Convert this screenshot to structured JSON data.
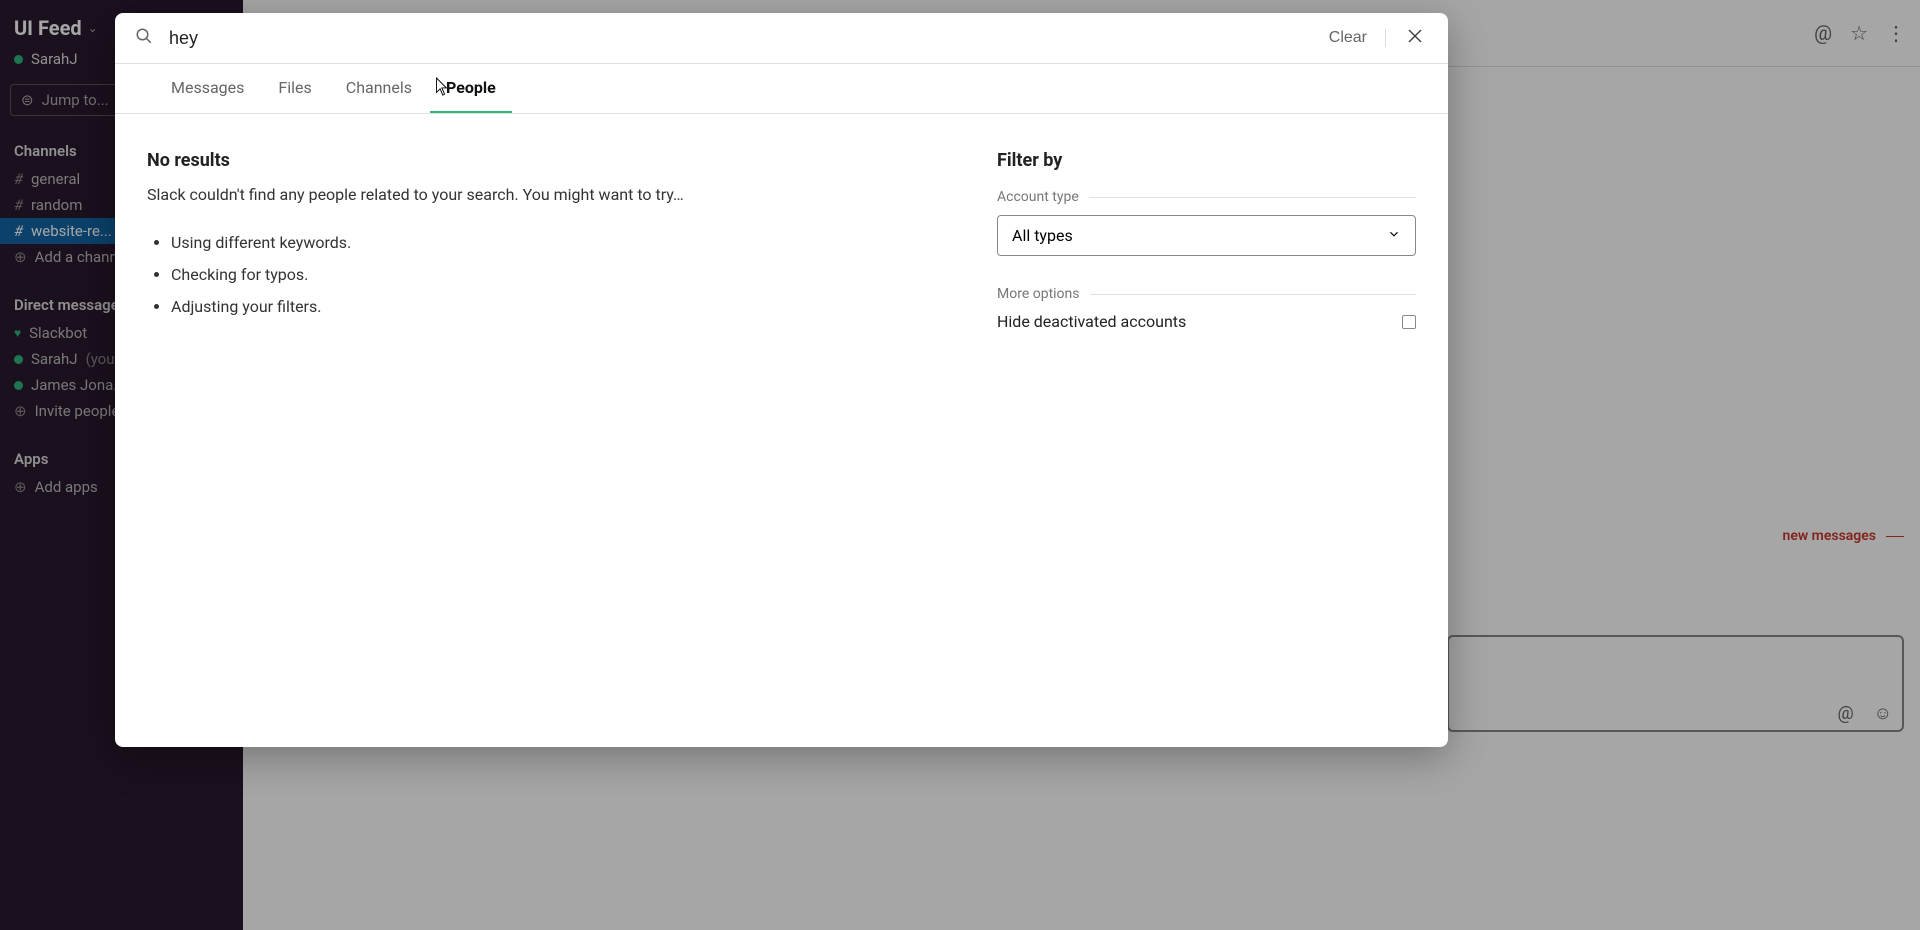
{
  "workspace": {
    "title": "UI Feed",
    "user": "SarahJ"
  },
  "jump_to": "Jump to...",
  "sidebar": {
    "channels_header": "Channels",
    "channels": [
      {
        "name": "general"
      },
      {
        "name": "random"
      },
      {
        "name": "website-re..."
      }
    ],
    "add_channel": "Add a channel",
    "dm_header": "Direct messages",
    "dms": [
      {
        "name": "Slackbot",
        "icon": "heart"
      },
      {
        "name": "SarahJ",
        "suffix": "(you)",
        "icon": "dot"
      },
      {
        "name": "James Jona...",
        "icon": "dot"
      }
    ],
    "invite": "Invite people",
    "apps_header": "Apps",
    "add_apps": "Add apps"
  },
  "top_bar": {
    "icons": [
      "mention",
      "star",
      "more"
    ]
  },
  "new_messages": "new messages",
  "search": {
    "query": "hey",
    "clear": "Clear",
    "tabs": [
      "Messages",
      "Files",
      "Channels",
      "People"
    ],
    "active_tab": 3,
    "no_results": {
      "title": "No results",
      "text": "Slack couldn't find any people related to your search. You might want to try…",
      "tips": [
        "Using different keywords.",
        "Checking for typos.",
        "Adjusting your filters."
      ]
    },
    "filter": {
      "title": "Filter by",
      "account_type_label": "Account type",
      "account_type_value": "All types",
      "more_options_label": "More options",
      "hide_deactivated": "Hide deactivated accounts"
    }
  }
}
